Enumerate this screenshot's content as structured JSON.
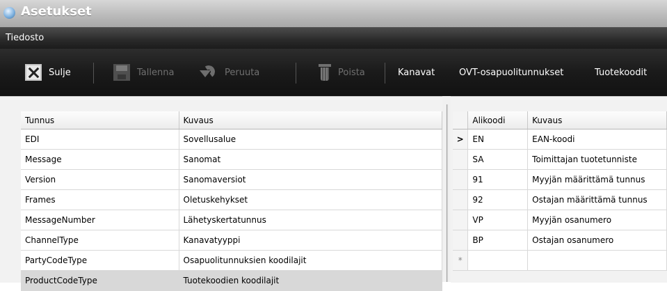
{
  "window": {
    "title": "Asetukset",
    "icon": "app-gear-icon"
  },
  "menu": {
    "items": [
      "Tiedosto"
    ]
  },
  "toolbar": {
    "close_label": "Sulje",
    "save_label": "Tallenna",
    "undo_label": "Peruuta",
    "delete_label": "Poista",
    "channels_label": "Kanavat",
    "ovt_label": "OVT-osapuolitunnukset",
    "productcodes_label": "Tuotekoodit"
  },
  "left_table": {
    "columns": [
      "Tunnus",
      "Kuvaus"
    ],
    "rows": [
      {
        "tunnus": "EDI",
        "kuvaus": "Sovellusalue"
      },
      {
        "tunnus": "Message",
        "kuvaus": "Sanomat"
      },
      {
        "tunnus": "Version",
        "kuvaus": "Sanomaversiot"
      },
      {
        "tunnus": "Frames",
        "kuvaus": "Oletuskehykset"
      },
      {
        "tunnus": "MessageNumber",
        "kuvaus": "Lähetyskertatunnus"
      },
      {
        "tunnus": "ChannelType",
        "kuvaus": "Kanavatyyppi"
      },
      {
        "tunnus": "PartyCodeType",
        "kuvaus": "Osapuolitunnuksien koodilajit"
      },
      {
        "tunnus": "ProductCodeType",
        "kuvaus": "Tuotekoodien koodilajit"
      }
    ],
    "selected_index": 7
  },
  "right_table": {
    "columns": [
      "Alikoodi",
      "Kuvaus"
    ],
    "current_marker": ">",
    "new_row_marker": "*",
    "rows": [
      {
        "alikoodi": "EN",
        "kuvaus": "EAN-koodi"
      },
      {
        "alikoodi": "SA",
        "kuvaus": "Toimittajan tuotetunniste"
      },
      {
        "alikoodi": "91",
        "kuvaus": "Myyjän määrittämä tunnus"
      },
      {
        "alikoodi": "92",
        "kuvaus": "Ostajan määrittämä tunnus"
      },
      {
        "alikoodi": "VP",
        "kuvaus": "Myyjän osanumero"
      },
      {
        "alikoodi": "BP",
        "kuvaus": "Ostajan osanumero"
      }
    ]
  }
}
